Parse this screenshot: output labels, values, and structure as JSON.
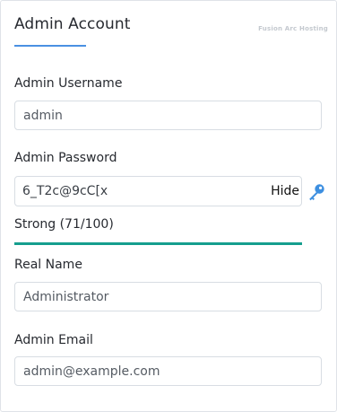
{
  "header": {
    "title": "Admin Account",
    "brand": "Fusion Arc Hosting"
  },
  "fields": {
    "username": {
      "label": "Admin Username",
      "value": "admin"
    },
    "password": {
      "label": "Admin Password",
      "value": "6_T2c@9cC[x",
      "toggle_label": "Hide"
    },
    "real_name": {
      "label": "Real Name",
      "value": "Administrator"
    },
    "email": {
      "label": "Admin Email",
      "value": "admin@example.com"
    }
  },
  "strength": {
    "text": "Strong (71/100)",
    "fill_fraction": 1.0,
    "color": "#169e8e"
  },
  "colors": {
    "accent": "#4a90e2",
    "key_icon": "#3d8fe0"
  },
  "icons": {
    "generate": "key-icon"
  }
}
